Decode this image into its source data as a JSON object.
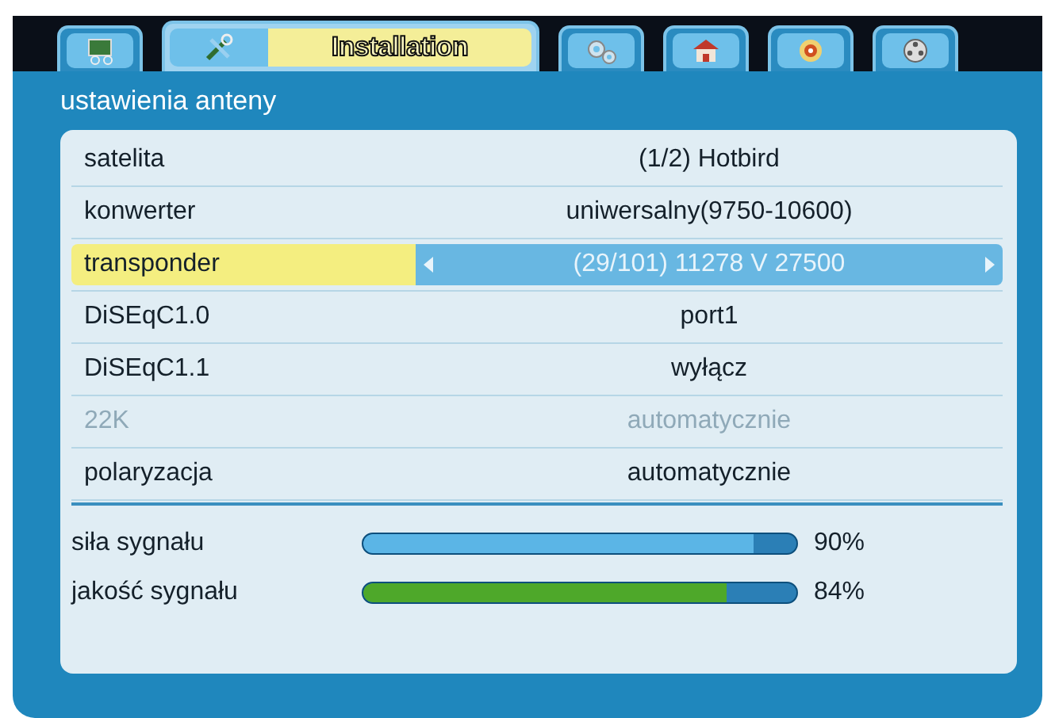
{
  "tabs": [
    {
      "selected": false
    },
    {
      "label": "Installation",
      "selected": true
    },
    {
      "selected": false
    },
    {
      "selected": false
    },
    {
      "selected": false
    },
    {
      "selected": false
    }
  ],
  "panel": {
    "title": "ustawienia anteny"
  },
  "rows": [
    {
      "label": "satelita",
      "value": "(1/2) Hotbird",
      "selected": false,
      "disabled": false
    },
    {
      "label": "konwerter",
      "value": "uniwersalny(9750-10600)",
      "selected": false,
      "disabled": false
    },
    {
      "label": "transponder",
      "value": "(29/101) 11278 V 27500",
      "selected": true,
      "disabled": false
    },
    {
      "label": "DiSEqC1.0",
      "value": "port1",
      "selected": false,
      "disabled": false
    },
    {
      "label": "DiSEqC1.1",
      "value": "wyłącz",
      "selected": false,
      "disabled": false
    },
    {
      "label": "22K",
      "value": "automatycznie",
      "selected": false,
      "disabled": true
    },
    {
      "label": "polaryzacja",
      "value": "automatycznie",
      "selected": false,
      "disabled": false
    }
  ],
  "meters": [
    {
      "label": "siła sygnału",
      "level": 0.9,
      "reading": "90%",
      "color": "#5bb5e6"
    },
    {
      "label": "jakość sygnału",
      "level": 0.84,
      "reading": "84%",
      "color": "#4ea82a"
    }
  ]
}
